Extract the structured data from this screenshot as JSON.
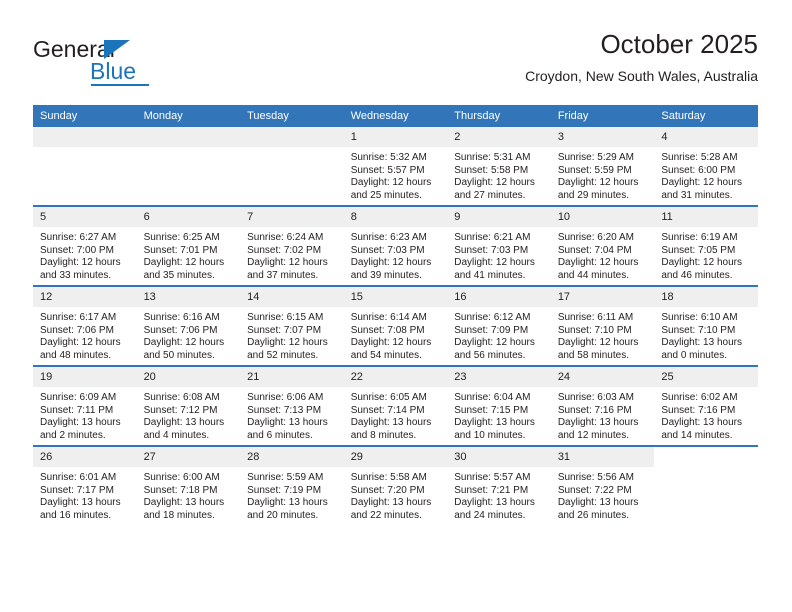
{
  "logo": {
    "word_general": "General",
    "word_blue": "Blue",
    "accent_color": "#1b75bb"
  },
  "header": {
    "title": "October 2025",
    "subtitle": "Croydon, New South Wales, Australia"
  },
  "calendar": {
    "header_bg": "#3275b9",
    "daynum_bg": "#efefef",
    "weekday_headers": [
      "Sunday",
      "Monday",
      "Tuesday",
      "Wednesday",
      "Thursday",
      "Friday",
      "Saturday"
    ],
    "weeks": [
      [
        {
          "day": "",
          "empty": true,
          "sunrise": "",
          "sunset": "",
          "daylight_line1": "",
          "daylight_line2": ""
        },
        {
          "day": "",
          "empty": true,
          "sunrise": "",
          "sunset": "",
          "daylight_line1": "",
          "daylight_line2": ""
        },
        {
          "day": "",
          "empty": true,
          "sunrise": "",
          "sunset": "",
          "daylight_line1": "",
          "daylight_line2": ""
        },
        {
          "day": "1",
          "sunrise": "Sunrise: 5:32 AM",
          "sunset": "Sunset: 5:57 PM",
          "daylight_line1": "Daylight: 12 hours",
          "daylight_line2": "and 25 minutes."
        },
        {
          "day": "2",
          "sunrise": "Sunrise: 5:31 AM",
          "sunset": "Sunset: 5:58 PM",
          "daylight_line1": "Daylight: 12 hours",
          "daylight_line2": "and 27 minutes."
        },
        {
          "day": "3",
          "sunrise": "Sunrise: 5:29 AM",
          "sunset": "Sunset: 5:59 PM",
          "daylight_line1": "Daylight: 12 hours",
          "daylight_line2": "and 29 minutes."
        },
        {
          "day": "4",
          "sunrise": "Sunrise: 5:28 AM",
          "sunset": "Sunset: 6:00 PM",
          "daylight_line1": "Daylight: 12 hours",
          "daylight_line2": "and 31 minutes."
        }
      ],
      [
        {
          "day": "5",
          "sunrise": "Sunrise: 6:27 AM",
          "sunset": "Sunset: 7:00 PM",
          "daylight_line1": "Daylight: 12 hours",
          "daylight_line2": "and 33 minutes."
        },
        {
          "day": "6",
          "sunrise": "Sunrise: 6:25 AM",
          "sunset": "Sunset: 7:01 PM",
          "daylight_line1": "Daylight: 12 hours",
          "daylight_line2": "and 35 minutes."
        },
        {
          "day": "7",
          "sunrise": "Sunrise: 6:24 AM",
          "sunset": "Sunset: 7:02 PM",
          "daylight_line1": "Daylight: 12 hours",
          "daylight_line2": "and 37 minutes."
        },
        {
          "day": "8",
          "sunrise": "Sunrise: 6:23 AM",
          "sunset": "Sunset: 7:03 PM",
          "daylight_line1": "Daylight: 12 hours",
          "daylight_line2": "and 39 minutes."
        },
        {
          "day": "9",
          "sunrise": "Sunrise: 6:21 AM",
          "sunset": "Sunset: 7:03 PM",
          "daylight_line1": "Daylight: 12 hours",
          "daylight_line2": "and 41 minutes."
        },
        {
          "day": "10",
          "sunrise": "Sunrise: 6:20 AM",
          "sunset": "Sunset: 7:04 PM",
          "daylight_line1": "Daylight: 12 hours",
          "daylight_line2": "and 44 minutes."
        },
        {
          "day": "11",
          "sunrise": "Sunrise: 6:19 AM",
          "sunset": "Sunset: 7:05 PM",
          "daylight_line1": "Daylight: 12 hours",
          "daylight_line2": "and 46 minutes."
        }
      ],
      [
        {
          "day": "12",
          "sunrise": "Sunrise: 6:17 AM",
          "sunset": "Sunset: 7:06 PM",
          "daylight_line1": "Daylight: 12 hours",
          "daylight_line2": "and 48 minutes."
        },
        {
          "day": "13",
          "sunrise": "Sunrise: 6:16 AM",
          "sunset": "Sunset: 7:06 PM",
          "daylight_line1": "Daylight: 12 hours",
          "daylight_line2": "and 50 minutes."
        },
        {
          "day": "14",
          "sunrise": "Sunrise: 6:15 AM",
          "sunset": "Sunset: 7:07 PM",
          "daylight_line1": "Daylight: 12 hours",
          "daylight_line2": "and 52 minutes."
        },
        {
          "day": "15",
          "sunrise": "Sunrise: 6:14 AM",
          "sunset": "Sunset: 7:08 PM",
          "daylight_line1": "Daylight: 12 hours",
          "daylight_line2": "and 54 minutes."
        },
        {
          "day": "16",
          "sunrise": "Sunrise: 6:12 AM",
          "sunset": "Sunset: 7:09 PM",
          "daylight_line1": "Daylight: 12 hours",
          "daylight_line2": "and 56 minutes."
        },
        {
          "day": "17",
          "sunrise": "Sunrise: 6:11 AM",
          "sunset": "Sunset: 7:10 PM",
          "daylight_line1": "Daylight: 12 hours",
          "daylight_line2": "and 58 minutes."
        },
        {
          "day": "18",
          "sunrise": "Sunrise: 6:10 AM",
          "sunset": "Sunset: 7:10 PM",
          "daylight_line1": "Daylight: 13 hours",
          "daylight_line2": "and 0 minutes."
        }
      ],
      [
        {
          "day": "19",
          "sunrise": "Sunrise: 6:09 AM",
          "sunset": "Sunset: 7:11 PM",
          "daylight_line1": "Daylight: 13 hours",
          "daylight_line2": "and 2 minutes."
        },
        {
          "day": "20",
          "sunrise": "Sunrise: 6:08 AM",
          "sunset": "Sunset: 7:12 PM",
          "daylight_line1": "Daylight: 13 hours",
          "daylight_line2": "and 4 minutes."
        },
        {
          "day": "21",
          "sunrise": "Sunrise: 6:06 AM",
          "sunset": "Sunset: 7:13 PM",
          "daylight_line1": "Daylight: 13 hours",
          "daylight_line2": "and 6 minutes."
        },
        {
          "day": "22",
          "sunrise": "Sunrise: 6:05 AM",
          "sunset": "Sunset: 7:14 PM",
          "daylight_line1": "Daylight: 13 hours",
          "daylight_line2": "and 8 minutes."
        },
        {
          "day": "23",
          "sunrise": "Sunrise: 6:04 AM",
          "sunset": "Sunset: 7:15 PM",
          "daylight_line1": "Daylight: 13 hours",
          "daylight_line2": "and 10 minutes."
        },
        {
          "day": "24",
          "sunrise": "Sunrise: 6:03 AM",
          "sunset": "Sunset: 7:16 PM",
          "daylight_line1": "Daylight: 13 hours",
          "daylight_line2": "and 12 minutes."
        },
        {
          "day": "25",
          "sunrise": "Sunrise: 6:02 AM",
          "sunset": "Sunset: 7:16 PM",
          "daylight_line1": "Daylight: 13 hours",
          "daylight_line2": "and 14 minutes."
        }
      ],
      [
        {
          "day": "26",
          "sunrise": "Sunrise: 6:01 AM",
          "sunset": "Sunset: 7:17 PM",
          "daylight_line1": "Daylight: 13 hours",
          "daylight_line2": "and 16 minutes."
        },
        {
          "day": "27",
          "sunrise": "Sunrise: 6:00 AM",
          "sunset": "Sunset: 7:18 PM",
          "daylight_line1": "Daylight: 13 hours",
          "daylight_line2": "and 18 minutes."
        },
        {
          "day": "28",
          "sunrise": "Sunrise: 5:59 AM",
          "sunset": "Sunset: 7:19 PM",
          "daylight_line1": "Daylight: 13 hours",
          "daylight_line2": "and 20 minutes."
        },
        {
          "day": "29",
          "sunrise": "Sunrise: 5:58 AM",
          "sunset": "Sunset: 7:20 PM",
          "daylight_line1": "Daylight: 13 hours",
          "daylight_line2": "and 22 minutes."
        },
        {
          "day": "30",
          "sunrise": "Sunrise: 5:57 AM",
          "sunset": "Sunset: 7:21 PM",
          "daylight_line1": "Daylight: 13 hours",
          "daylight_line2": "and 24 minutes."
        },
        {
          "day": "31",
          "sunrise": "Sunrise: 5:56 AM",
          "sunset": "Sunset: 7:22 PM",
          "daylight_line1": "Daylight: 13 hours",
          "daylight_line2": "and 26 minutes."
        },
        {
          "day": "",
          "empty": true,
          "blank": true,
          "sunrise": "",
          "sunset": "",
          "daylight_line1": "",
          "daylight_line2": ""
        }
      ]
    ]
  }
}
